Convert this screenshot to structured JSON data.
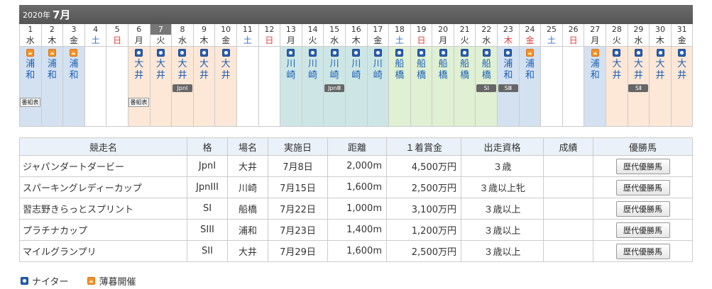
{
  "calendar": {
    "year": "2020年",
    "month": "7月",
    "days": [
      {
        "d": "1",
        "w": "水",
        "k": "",
        "icon": "twilight",
        "venue": "浦和",
        "bg": "urawa",
        "grade": "",
        "prog": "番組表"
      },
      {
        "d": "2",
        "w": "木",
        "k": "",
        "icon": "twilight",
        "venue": "浦和",
        "bg": "urawa",
        "grade": "",
        "prog": ""
      },
      {
        "d": "3",
        "w": "金",
        "k": "",
        "icon": "twilight",
        "venue": "浦和",
        "bg": "urawa",
        "grade": "",
        "prog": ""
      },
      {
        "d": "4",
        "w": "土",
        "k": "sat",
        "icon": "",
        "venue": "",
        "bg": "",
        "grade": "",
        "prog": ""
      },
      {
        "d": "5",
        "w": "日",
        "k": "sun",
        "icon": "",
        "venue": "",
        "bg": "",
        "grade": "",
        "prog": ""
      },
      {
        "d": "6",
        "w": "月",
        "k": "",
        "icon": "night",
        "venue": "大井",
        "bg": "ooi",
        "grade": "",
        "prog": "番組表"
      },
      {
        "d": "7",
        "w": "火",
        "k": "",
        "icon": "night",
        "venue": "大井",
        "bg": "ooi",
        "grade": "",
        "prog": "",
        "today": true
      },
      {
        "d": "8",
        "w": "水",
        "k": "",
        "icon": "night",
        "venue": "大井",
        "bg": "ooi",
        "grade": "JpnⅠ",
        "prog": ""
      },
      {
        "d": "9",
        "w": "木",
        "k": "",
        "icon": "night",
        "venue": "大井",
        "bg": "ooi",
        "grade": "",
        "prog": ""
      },
      {
        "d": "10",
        "w": "金",
        "k": "",
        "icon": "night",
        "venue": "大井",
        "bg": "ooi",
        "grade": "",
        "prog": ""
      },
      {
        "d": "11",
        "w": "土",
        "k": "sat",
        "icon": "",
        "venue": "",
        "bg": "",
        "grade": "",
        "prog": ""
      },
      {
        "d": "12",
        "w": "日",
        "k": "sun",
        "icon": "",
        "venue": "",
        "bg": "",
        "grade": "",
        "prog": ""
      },
      {
        "d": "13",
        "w": "月",
        "k": "",
        "icon": "night",
        "venue": "川崎",
        "bg": "kawa",
        "grade": "",
        "prog": ""
      },
      {
        "d": "14",
        "w": "火",
        "k": "",
        "icon": "night",
        "venue": "川崎",
        "bg": "kawa",
        "grade": "",
        "prog": ""
      },
      {
        "d": "15",
        "w": "水",
        "k": "",
        "icon": "night",
        "venue": "川崎",
        "bg": "kawa",
        "grade": "JpnⅢ",
        "prog": ""
      },
      {
        "d": "16",
        "w": "木",
        "k": "",
        "icon": "night",
        "venue": "川崎",
        "bg": "kawa",
        "grade": "",
        "prog": ""
      },
      {
        "d": "17",
        "w": "金",
        "k": "",
        "icon": "night",
        "venue": "川崎",
        "bg": "kawa",
        "grade": "",
        "prog": ""
      },
      {
        "d": "18",
        "w": "土",
        "k": "sat",
        "icon": "night",
        "venue": "船橋",
        "bg": "fune",
        "grade": "",
        "prog": ""
      },
      {
        "d": "19",
        "w": "日",
        "k": "sun",
        "icon": "night",
        "venue": "船橋",
        "bg": "fune",
        "grade": "",
        "prog": ""
      },
      {
        "d": "20",
        "w": "月",
        "k": "",
        "icon": "night",
        "venue": "船橋",
        "bg": "fune",
        "grade": "",
        "prog": ""
      },
      {
        "d": "21",
        "w": "火",
        "k": "",
        "icon": "night",
        "venue": "船橋",
        "bg": "fune",
        "grade": "",
        "prog": ""
      },
      {
        "d": "22",
        "w": "水",
        "k": "",
        "icon": "night",
        "venue": "船橋",
        "bg": "fune",
        "grade": "SⅠ",
        "prog": ""
      },
      {
        "d": "23",
        "w": "木",
        "k": "sun",
        "icon": "night",
        "venue": "浦和",
        "bg": "urawa",
        "grade": "SⅢ",
        "prog": ""
      },
      {
        "d": "24",
        "w": "金",
        "k": "sun",
        "icon": "twilight",
        "venue": "浦和",
        "bg": "urawa",
        "grade": "",
        "prog": ""
      },
      {
        "d": "25",
        "w": "土",
        "k": "sat",
        "icon": "",
        "venue": "",
        "bg": "",
        "grade": "",
        "prog": ""
      },
      {
        "d": "26",
        "w": "日",
        "k": "sun",
        "icon": "",
        "venue": "",
        "bg": "",
        "grade": "",
        "prog": ""
      },
      {
        "d": "27",
        "w": "月",
        "k": "",
        "icon": "twilight",
        "venue": "浦和",
        "bg": "urawa",
        "grade": "",
        "prog": ""
      },
      {
        "d": "28",
        "w": "火",
        "k": "",
        "icon": "night",
        "venue": "大井",
        "bg": "ooi",
        "grade": "",
        "prog": ""
      },
      {
        "d": "29",
        "w": "水",
        "k": "",
        "icon": "night",
        "venue": "大井",
        "bg": "ooi",
        "grade": "SⅡ",
        "prog": ""
      },
      {
        "d": "30",
        "w": "木",
        "k": "",
        "icon": "night",
        "venue": "大井",
        "bg": "ooi",
        "grade": "",
        "prog": ""
      },
      {
        "d": "31",
        "w": "金",
        "k": "",
        "icon": "night",
        "venue": "大井",
        "bg": "ooi",
        "grade": "",
        "prog": ""
      }
    ]
  },
  "table": {
    "headers": {
      "name": "競走名",
      "grade": "格",
      "venue": "場名",
      "date": "実施日",
      "distance": "距離",
      "prize": "１着賞金",
      "qual": "出走資格",
      "result": "成績",
      "winner": "優勝馬"
    },
    "rows": [
      {
        "name": "ジャパンダートダービー",
        "grade": "JpnI",
        "venue": "大井",
        "date": "7月8日",
        "distance": "2,000m",
        "prize": "4,500万円",
        "qual": "３歳",
        "result": "",
        "button": "歴代優勝馬"
      },
      {
        "name": "スパーキングレディーカップ",
        "grade": "JpnIII",
        "venue": "川崎",
        "date": "7月15日",
        "distance": "1,600m",
        "prize": "2,500万円",
        "qual": "３歳以上牝",
        "result": "",
        "button": "歴代優勝馬"
      },
      {
        "name": "習志野きらっとスプリント",
        "grade": "SI",
        "venue": "船橋",
        "date": "7月22日",
        "distance": "1,000m",
        "prize": "3,100万円",
        "qual": "３歳以上",
        "result": "",
        "button": "歴代優勝馬"
      },
      {
        "name": "プラチナカップ",
        "grade": "SIII",
        "venue": "浦和",
        "date": "7月23日",
        "distance": "1,400m",
        "prize": "1,200万円",
        "qual": "３歳以上",
        "result": "",
        "button": "歴代優勝馬"
      },
      {
        "name": "マイルグランプリ",
        "grade": "SII",
        "venue": "大井",
        "date": "7月29日",
        "distance": "1,600m",
        "prize": "2,500万円",
        "qual": "３歳以上",
        "result": "",
        "button": "歴代優勝馬"
      }
    ]
  },
  "legend": {
    "night_label": "ナイター",
    "twilight_label": "薄暮開催"
  },
  "colors": {
    "urawa_bg": "#d4e1f1",
    "ooi_bg": "#fde7d6",
    "kawasaki_bg": "#cde6e5",
    "funabashi_bg": "#dff0d3",
    "night_icon": "#2a5fb0",
    "twilight_icon": "#f2922b"
  }
}
